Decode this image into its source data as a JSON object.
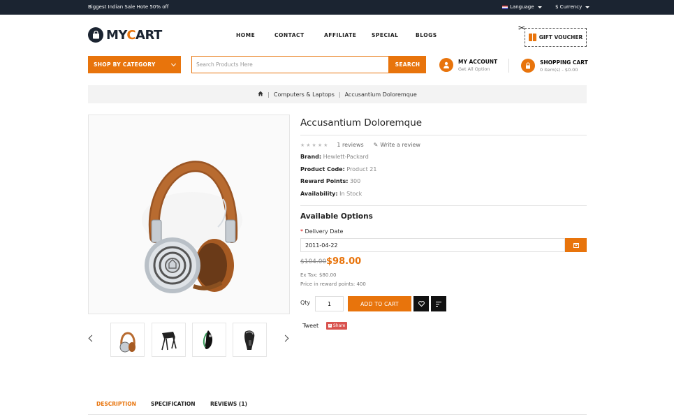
{
  "topbar": {
    "promo": "Biggest Indian Sale Hote 50% off",
    "language": "Language",
    "currency": "$ Currency"
  },
  "logo": {
    "part1": "MY",
    "part2": "C",
    "part3": "ART"
  },
  "nav": [
    "HOME",
    "CONTACT",
    "AFFILIATE",
    "SPECIAL",
    "BLOGS"
  ],
  "voucher": "GIFT VOUCHER",
  "category_button": "SHOP BY CATEGORY",
  "search": {
    "placeholder": "Search Products Here",
    "button": "SEARCH"
  },
  "account": {
    "title": "MY ACCOUNT",
    "subtitle": "Get All Option"
  },
  "cart": {
    "title": "SHOPPING CART",
    "subtitle": "0 item(s) - $0.00"
  },
  "breadcrumb": [
    "Computers & Laptops",
    "Accusantium Doloremque"
  ],
  "product": {
    "title": "Accusantium Doloremque",
    "reviews": "1 reviews",
    "write_review": "Write a review",
    "brand_label": "Brand:",
    "brand": "Hewlett-Packard",
    "code_label": "Product Code:",
    "code": "Product 21",
    "reward_label": "Reward Points:",
    "reward": "300",
    "avail_label": "Availability:",
    "availability": "In Stock",
    "rating": 0
  },
  "options": {
    "heading": "Available Options",
    "req": "*",
    "delivery_label": "Delivery Date",
    "delivery_value": "2011-04-22"
  },
  "pricing": {
    "old": "$104.00",
    "new": "$98.00",
    "ex_tax": "Ex Tax: $80.00",
    "reward_price": "Price in reward points: 400"
  },
  "purchase": {
    "qty_label": "Qty",
    "qty": "1",
    "add_to_cart": "ADD TO CART"
  },
  "social": {
    "tweet": "Tweet",
    "share": "Share"
  },
  "tabs": [
    "DESCRIPTION",
    "SPECIFICATION",
    "REVIEWS (1)"
  ],
  "colors": {
    "accent": "#e8740c",
    "dark": "#1b2431"
  }
}
